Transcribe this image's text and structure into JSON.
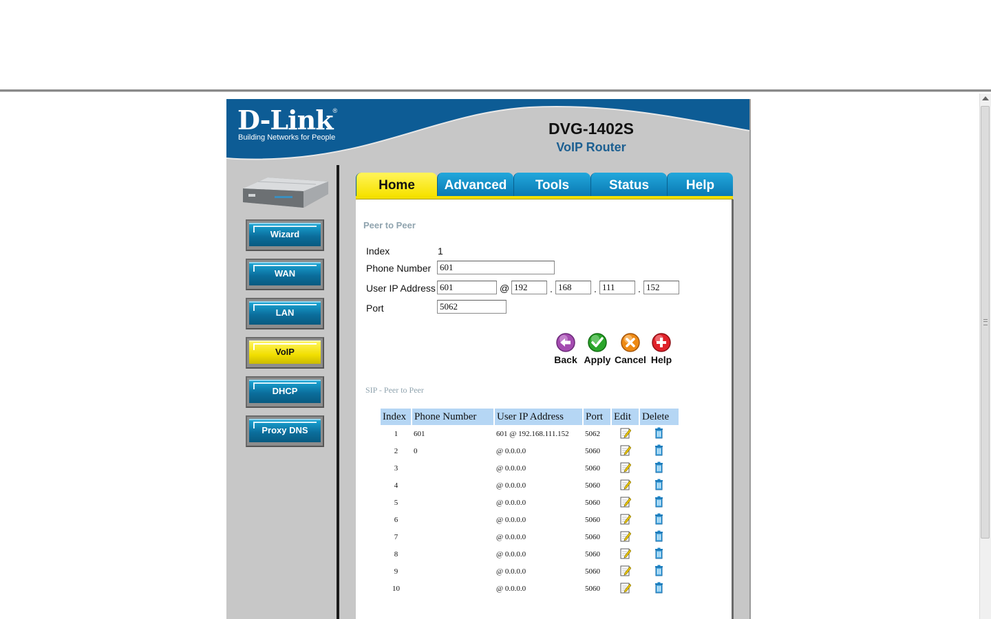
{
  "header": {
    "brand": "D-Link",
    "brand_mark": "®",
    "tagline": "Building Networks for People",
    "model": "DVG-1402S",
    "subtitle": "VoIP Router"
  },
  "sidebar": {
    "items": [
      {
        "label": "Wizard",
        "active": false
      },
      {
        "label": "WAN",
        "active": false
      },
      {
        "label": "LAN",
        "active": false
      },
      {
        "label": "VoIP",
        "active": true
      },
      {
        "label": "DHCP",
        "active": false
      },
      {
        "label": "Proxy DNS",
        "active": false
      }
    ]
  },
  "tabs": [
    {
      "label": "Home",
      "active": true
    },
    {
      "label": "Advanced",
      "active": false
    },
    {
      "label": "Tools",
      "active": false
    },
    {
      "label": "Status",
      "active": false
    },
    {
      "label": "Help",
      "active": false
    }
  ],
  "form": {
    "title": "Peer to Peer",
    "index_label": "Index",
    "index_value": "1",
    "phone_label": "Phone Number",
    "phone_value": "601",
    "ip_label": "User IP Address",
    "ip_user": "601",
    "at_sign": "@",
    "ip_octets": [
      "192",
      "168",
      "111",
      "152"
    ],
    "dot": ".",
    "port_label": "Port",
    "port_value": "5062"
  },
  "actions": {
    "back": "Back",
    "apply": "Apply",
    "cancel": "Cancel",
    "help": "Help"
  },
  "table": {
    "title": "SIP - Peer to Peer",
    "headers": [
      "Index",
      "Phone Number",
      "User IP Address",
      "Port",
      "Edit",
      "Delete"
    ],
    "rows": [
      {
        "index": "1",
        "phone": "601",
        "ip": "601 @ 192.168.111.152",
        "port": "5062"
      },
      {
        "index": "2",
        "phone": "0",
        "ip": "@ 0.0.0.0",
        "port": "5060"
      },
      {
        "index": "3",
        "phone": "",
        "ip": "@ 0.0.0.0",
        "port": "5060"
      },
      {
        "index": "4",
        "phone": "",
        "ip": "@ 0.0.0.0",
        "port": "5060"
      },
      {
        "index": "5",
        "phone": "",
        "ip": "@ 0.0.0.0",
        "port": "5060"
      },
      {
        "index": "6",
        "phone": "",
        "ip": "@ 0.0.0.0",
        "port": "5060"
      },
      {
        "index": "7",
        "phone": "",
        "ip": "@ 0.0.0.0",
        "port": "5060"
      },
      {
        "index": "8",
        "phone": "",
        "ip": "@ 0.0.0.0",
        "port": "5060"
      },
      {
        "index": "9",
        "phone": "",
        "ip": "@ 0.0.0.0",
        "port": "5060"
      },
      {
        "index": "10",
        "phone": "",
        "ip": "@ 0.0.0.0",
        "port": "5060"
      }
    ]
  },
  "colors": {
    "brand_blue": "#0d5c95",
    "nav_blue": "#0b6e9c",
    "active_yellow": "#f1de00",
    "table_header": "#b5d6f4",
    "section_title": "#8fa3ae"
  }
}
